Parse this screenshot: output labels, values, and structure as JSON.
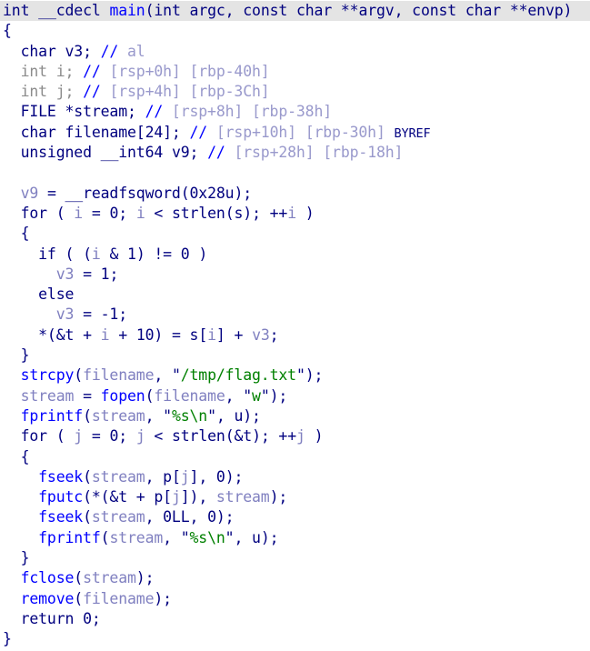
{
  "app": {
    "view_name": "ida-pseudocode-view",
    "background": "#ffffff",
    "highlight_color": "#e4e4e4"
  },
  "colors": {
    "keyword": "#00007f",
    "function": "#0000ff",
    "local_var": "#8080c0",
    "dimmed": "#8c8c8c",
    "comment": "#9999cc",
    "string": "#008000",
    "punctuation": "#000080"
  },
  "code": {
    "language": "c-pseudocode",
    "lines": [
      {
        "n": 1,
        "highlighted": true,
        "tokens": [
          {
            "t": "int",
            "c": "t-kw"
          },
          {
            "t": " ",
            "c": "t-punc"
          },
          {
            "t": "__cdecl",
            "c": "t-kw"
          },
          {
            "t": " ",
            "c": "t-punc"
          },
          {
            "t": "main",
            "c": "t-fn"
          },
          {
            "t": "(",
            "c": "t-punc"
          },
          {
            "t": "int",
            "c": "t-kw"
          },
          {
            "t": " argc, ",
            "c": "t-punc"
          },
          {
            "t": "const",
            "c": "t-kw"
          },
          {
            "t": " ",
            "c": "t-punc"
          },
          {
            "t": "char",
            "c": "t-kw"
          },
          {
            "t": " **argv, ",
            "c": "t-punc"
          },
          {
            "t": "const",
            "c": "t-kw"
          },
          {
            "t": " ",
            "c": "t-punc"
          },
          {
            "t": "char",
            "c": "t-kw"
          },
          {
            "t": " **envp)",
            "c": "t-punc"
          }
        ]
      },
      {
        "n": 2,
        "highlighted": false,
        "tokens": [
          {
            "t": "{",
            "c": "t-punc"
          }
        ]
      },
      {
        "n": 3,
        "highlighted": false,
        "tokens": [
          {
            "t": "  ",
            "c": "t-punc"
          },
          {
            "t": "char",
            "c": "t-kw"
          },
          {
            "t": " v3; ",
            "c": "t-kw"
          },
          {
            "t": "//",
            "c": "t-cmtmark"
          },
          {
            "t": " al",
            "c": "t-cmt"
          }
        ]
      },
      {
        "n": 4,
        "highlighted": false,
        "tokens": [
          {
            "t": "  ",
            "c": "t-punc"
          },
          {
            "t": "int i; ",
            "c": "t-gray"
          },
          {
            "t": "//",
            "c": "t-cmtmark"
          },
          {
            "t": " [rsp+0h] [rbp-40h]",
            "c": "t-cmt"
          }
        ]
      },
      {
        "n": 5,
        "highlighted": false,
        "tokens": [
          {
            "t": "  ",
            "c": "t-punc"
          },
          {
            "t": "int j; ",
            "c": "t-gray"
          },
          {
            "t": "//",
            "c": "t-cmtmark"
          },
          {
            "t": " [rsp+4h] [rbp-3Ch]",
            "c": "t-cmt"
          }
        ]
      },
      {
        "n": 6,
        "highlighted": false,
        "tokens": [
          {
            "t": "  ",
            "c": "t-punc"
          },
          {
            "t": "FILE",
            "c": "t-kw"
          },
          {
            "t": " *stream; ",
            "c": "t-kw"
          },
          {
            "t": "//",
            "c": "t-cmtmark"
          },
          {
            "t": " [rsp+8h] [rbp-38h]",
            "c": "t-cmt"
          }
        ]
      },
      {
        "n": 7,
        "highlighted": false,
        "tokens": [
          {
            "t": "  ",
            "c": "t-punc"
          },
          {
            "t": "char",
            "c": "t-kw"
          },
          {
            "t": " filename[",
            "c": "t-kw"
          },
          {
            "t": "24",
            "c": "t-num"
          },
          {
            "t": "]; ",
            "c": "t-kw"
          },
          {
            "t": "//",
            "c": "t-cmtmark"
          },
          {
            "t": " [rsp+10h] [rbp-30h] ",
            "c": "t-cmt"
          },
          {
            "t": "BYREF",
            "c": "t-byref"
          }
        ]
      },
      {
        "n": 8,
        "highlighted": false,
        "tokens": [
          {
            "t": "  ",
            "c": "t-punc"
          },
          {
            "t": "unsigned",
            "c": "t-kw"
          },
          {
            "t": " ",
            "c": "t-punc"
          },
          {
            "t": "__int64",
            "c": "t-kw"
          },
          {
            "t": " v9; ",
            "c": "t-kw"
          },
          {
            "t": "//",
            "c": "t-cmtmark"
          },
          {
            "t": " [rsp+28h] [rbp-18h]",
            "c": "t-cmt"
          }
        ]
      },
      {
        "n": 9,
        "highlighted": false,
        "tokens": []
      },
      {
        "n": 10,
        "highlighted": false,
        "tokens": [
          {
            "t": "  ",
            "c": "t-punc"
          },
          {
            "t": "v9",
            "c": "t-lvar"
          },
          {
            "t": " = ",
            "c": "t-punc"
          },
          {
            "t": "__readfsqword",
            "c": "t-kw"
          },
          {
            "t": "(",
            "c": "t-punc"
          },
          {
            "t": "0x28u",
            "c": "t-num"
          },
          {
            "t": ");",
            "c": "t-punc"
          }
        ]
      },
      {
        "n": 11,
        "highlighted": false,
        "tokens": [
          {
            "t": "  ",
            "c": "t-punc"
          },
          {
            "t": "for",
            "c": "t-kw"
          },
          {
            "t": " ( ",
            "c": "t-punc"
          },
          {
            "t": "i",
            "c": "t-lvar"
          },
          {
            "t": " = ",
            "c": "t-punc"
          },
          {
            "t": "0",
            "c": "t-num"
          },
          {
            "t": "; ",
            "c": "t-punc"
          },
          {
            "t": "i",
            "c": "t-lvar"
          },
          {
            "t": " < ",
            "c": "t-punc"
          },
          {
            "t": "strlen",
            "c": "t-kw"
          },
          {
            "t": "(",
            "c": "t-punc"
          },
          {
            "t": "s",
            "c": "t-kw"
          },
          {
            "t": "); ++",
            "c": "t-punc"
          },
          {
            "t": "i",
            "c": "t-lvar"
          },
          {
            "t": " )",
            "c": "t-punc"
          }
        ]
      },
      {
        "n": 12,
        "highlighted": false,
        "tokens": [
          {
            "t": "  {",
            "c": "t-punc"
          }
        ]
      },
      {
        "n": 13,
        "highlighted": false,
        "tokens": [
          {
            "t": "    ",
            "c": "t-punc"
          },
          {
            "t": "if",
            "c": "t-kw"
          },
          {
            "t": " ( (",
            "c": "t-punc"
          },
          {
            "t": "i",
            "c": "t-lvar"
          },
          {
            "t": " & ",
            "c": "t-punc"
          },
          {
            "t": "1",
            "c": "t-num"
          },
          {
            "t": ") != ",
            "c": "t-punc"
          },
          {
            "t": "0",
            "c": "t-num"
          },
          {
            "t": " )",
            "c": "t-punc"
          }
        ]
      },
      {
        "n": 14,
        "highlighted": false,
        "tokens": [
          {
            "t": "      ",
            "c": "t-punc"
          },
          {
            "t": "v3",
            "c": "t-lvar"
          },
          {
            "t": " = ",
            "c": "t-punc"
          },
          {
            "t": "1",
            "c": "t-num"
          },
          {
            "t": ";",
            "c": "t-punc"
          }
        ]
      },
      {
        "n": 15,
        "highlighted": false,
        "tokens": [
          {
            "t": "    ",
            "c": "t-punc"
          },
          {
            "t": "else",
            "c": "t-kw"
          }
        ]
      },
      {
        "n": 16,
        "highlighted": false,
        "tokens": [
          {
            "t": "      ",
            "c": "t-punc"
          },
          {
            "t": "v3",
            "c": "t-lvar"
          },
          {
            "t": " = -",
            "c": "t-punc"
          },
          {
            "t": "1",
            "c": "t-num"
          },
          {
            "t": ";",
            "c": "t-punc"
          }
        ]
      },
      {
        "n": 17,
        "highlighted": false,
        "tokens": [
          {
            "t": "    *(&",
            "c": "t-punc"
          },
          {
            "t": "t",
            "c": "t-kw"
          },
          {
            "t": " + ",
            "c": "t-punc"
          },
          {
            "t": "i",
            "c": "t-lvar"
          },
          {
            "t": " + ",
            "c": "t-punc"
          },
          {
            "t": "10",
            "c": "t-num"
          },
          {
            "t": ") = ",
            "c": "t-punc"
          },
          {
            "t": "s",
            "c": "t-kw"
          },
          {
            "t": "[",
            "c": "t-punc"
          },
          {
            "t": "i",
            "c": "t-lvar"
          },
          {
            "t": "] + ",
            "c": "t-punc"
          },
          {
            "t": "v3",
            "c": "t-lvar"
          },
          {
            "t": ";",
            "c": "t-punc"
          }
        ]
      },
      {
        "n": 18,
        "highlighted": false,
        "tokens": [
          {
            "t": "  }",
            "c": "t-punc"
          }
        ]
      },
      {
        "n": 19,
        "highlighted": false,
        "tokens": [
          {
            "t": "  ",
            "c": "t-punc"
          },
          {
            "t": "strcpy",
            "c": "t-fn"
          },
          {
            "t": "(",
            "c": "t-punc"
          },
          {
            "t": "filename",
            "c": "t-lvar"
          },
          {
            "t": ", ",
            "c": "t-punc"
          },
          {
            "t": "\"",
            "c": "t-quote"
          },
          {
            "t": "/tmp/flag.txt",
            "c": "t-str"
          },
          {
            "t": "\"",
            "c": "t-quote"
          },
          {
            "t": ");",
            "c": "t-punc"
          }
        ]
      },
      {
        "n": 20,
        "highlighted": false,
        "tokens": [
          {
            "t": "  ",
            "c": "t-punc"
          },
          {
            "t": "stream",
            "c": "t-lvar"
          },
          {
            "t": " = ",
            "c": "t-punc"
          },
          {
            "t": "fopen",
            "c": "t-fn"
          },
          {
            "t": "(",
            "c": "t-punc"
          },
          {
            "t": "filename",
            "c": "t-lvar"
          },
          {
            "t": ", ",
            "c": "t-punc"
          },
          {
            "t": "\"",
            "c": "t-quote"
          },
          {
            "t": "w",
            "c": "t-str"
          },
          {
            "t": "\"",
            "c": "t-quote"
          },
          {
            "t": ");",
            "c": "t-punc"
          }
        ]
      },
      {
        "n": 21,
        "highlighted": false,
        "tokens": [
          {
            "t": "  ",
            "c": "t-punc"
          },
          {
            "t": "fprintf",
            "c": "t-fn"
          },
          {
            "t": "(",
            "c": "t-punc"
          },
          {
            "t": "stream",
            "c": "t-lvar"
          },
          {
            "t": ", ",
            "c": "t-punc"
          },
          {
            "t": "\"",
            "c": "t-quote"
          },
          {
            "t": "%s\\n",
            "c": "t-str"
          },
          {
            "t": "\"",
            "c": "t-quote"
          },
          {
            "t": ", ",
            "c": "t-punc"
          },
          {
            "t": "u",
            "c": "t-kw"
          },
          {
            "t": ");",
            "c": "t-punc"
          }
        ]
      },
      {
        "n": 22,
        "highlighted": false,
        "tokens": [
          {
            "t": "  ",
            "c": "t-punc"
          },
          {
            "t": "for",
            "c": "t-kw"
          },
          {
            "t": " ( ",
            "c": "t-punc"
          },
          {
            "t": "j",
            "c": "t-lvar"
          },
          {
            "t": " = ",
            "c": "t-punc"
          },
          {
            "t": "0",
            "c": "t-num"
          },
          {
            "t": "; ",
            "c": "t-punc"
          },
          {
            "t": "j",
            "c": "t-lvar"
          },
          {
            "t": " < ",
            "c": "t-punc"
          },
          {
            "t": "strlen",
            "c": "t-kw"
          },
          {
            "t": "(&",
            "c": "t-punc"
          },
          {
            "t": "t",
            "c": "t-kw"
          },
          {
            "t": "); ++",
            "c": "t-punc"
          },
          {
            "t": "j",
            "c": "t-lvar"
          },
          {
            "t": " )",
            "c": "t-punc"
          }
        ]
      },
      {
        "n": 23,
        "highlighted": false,
        "tokens": [
          {
            "t": "  {",
            "c": "t-punc"
          }
        ]
      },
      {
        "n": 24,
        "highlighted": false,
        "tokens": [
          {
            "t": "    ",
            "c": "t-punc"
          },
          {
            "t": "fseek",
            "c": "t-fn"
          },
          {
            "t": "(",
            "c": "t-punc"
          },
          {
            "t": "stream",
            "c": "t-lvar"
          },
          {
            "t": ", ",
            "c": "t-punc"
          },
          {
            "t": "p",
            "c": "t-kw"
          },
          {
            "t": "[",
            "c": "t-punc"
          },
          {
            "t": "j",
            "c": "t-lvar"
          },
          {
            "t": "], ",
            "c": "t-punc"
          },
          {
            "t": "0",
            "c": "t-num"
          },
          {
            "t": ");",
            "c": "t-punc"
          }
        ]
      },
      {
        "n": 25,
        "highlighted": false,
        "tokens": [
          {
            "t": "    ",
            "c": "t-punc"
          },
          {
            "t": "fputc",
            "c": "t-fn"
          },
          {
            "t": "(*(&",
            "c": "t-punc"
          },
          {
            "t": "t",
            "c": "t-kw"
          },
          {
            "t": " + ",
            "c": "t-punc"
          },
          {
            "t": "p",
            "c": "t-kw"
          },
          {
            "t": "[",
            "c": "t-punc"
          },
          {
            "t": "j",
            "c": "t-lvar"
          },
          {
            "t": "]), ",
            "c": "t-punc"
          },
          {
            "t": "stream",
            "c": "t-lvar"
          },
          {
            "t": ");",
            "c": "t-punc"
          }
        ]
      },
      {
        "n": 26,
        "highlighted": false,
        "tokens": [
          {
            "t": "    ",
            "c": "t-punc"
          },
          {
            "t": "fseek",
            "c": "t-fn"
          },
          {
            "t": "(",
            "c": "t-punc"
          },
          {
            "t": "stream",
            "c": "t-lvar"
          },
          {
            "t": ", ",
            "c": "t-punc"
          },
          {
            "t": "0LL",
            "c": "t-num"
          },
          {
            "t": ", ",
            "c": "t-punc"
          },
          {
            "t": "0",
            "c": "t-num"
          },
          {
            "t": ");",
            "c": "t-punc"
          }
        ]
      },
      {
        "n": 27,
        "highlighted": false,
        "tokens": [
          {
            "t": "    ",
            "c": "t-punc"
          },
          {
            "t": "fprintf",
            "c": "t-fn"
          },
          {
            "t": "(",
            "c": "t-punc"
          },
          {
            "t": "stream",
            "c": "t-lvar"
          },
          {
            "t": ", ",
            "c": "t-punc"
          },
          {
            "t": "\"",
            "c": "t-quote"
          },
          {
            "t": "%s\\n",
            "c": "t-str"
          },
          {
            "t": "\"",
            "c": "t-quote"
          },
          {
            "t": ", ",
            "c": "t-punc"
          },
          {
            "t": "u",
            "c": "t-kw"
          },
          {
            "t": ");",
            "c": "t-punc"
          }
        ]
      },
      {
        "n": 28,
        "highlighted": false,
        "tokens": [
          {
            "t": "  }",
            "c": "t-punc"
          }
        ]
      },
      {
        "n": 29,
        "highlighted": false,
        "tokens": [
          {
            "t": "  ",
            "c": "t-punc"
          },
          {
            "t": "fclose",
            "c": "t-fn"
          },
          {
            "t": "(",
            "c": "t-punc"
          },
          {
            "t": "stream",
            "c": "t-lvar"
          },
          {
            "t": ");",
            "c": "t-punc"
          }
        ]
      },
      {
        "n": 30,
        "highlighted": false,
        "tokens": [
          {
            "t": "  ",
            "c": "t-punc"
          },
          {
            "t": "remove",
            "c": "t-fn"
          },
          {
            "t": "(",
            "c": "t-punc"
          },
          {
            "t": "filename",
            "c": "t-lvar"
          },
          {
            "t": ");",
            "c": "t-punc"
          }
        ]
      },
      {
        "n": 31,
        "highlighted": false,
        "tokens": [
          {
            "t": "  ",
            "c": "t-punc"
          },
          {
            "t": "return",
            "c": "t-kw"
          },
          {
            "t": " ",
            "c": "t-punc"
          },
          {
            "t": "0",
            "c": "t-num"
          },
          {
            "t": ";",
            "c": "t-punc"
          }
        ]
      },
      {
        "n": 32,
        "highlighted": false,
        "tokens": [
          {
            "t": "}",
            "c": "t-punc"
          }
        ]
      }
    ]
  }
}
